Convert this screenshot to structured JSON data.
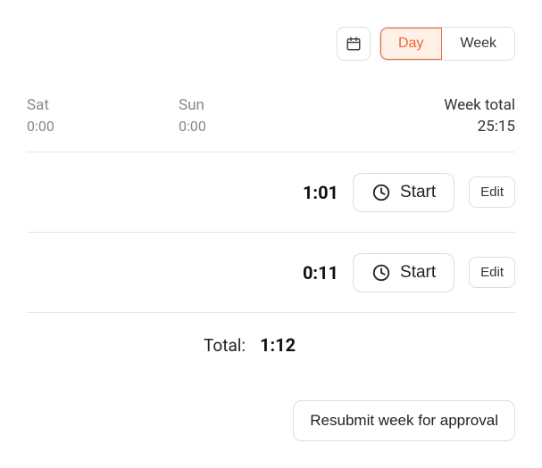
{
  "toolbar": {
    "tabs": {
      "day": "Day",
      "week": "Week"
    },
    "active_tab": "day"
  },
  "days": {
    "sat": {
      "label": "Sat",
      "value": "0:00"
    },
    "sun": {
      "label": "Sun",
      "value": "0:00"
    }
  },
  "week_total": {
    "label": "Week total",
    "value": "25:15"
  },
  "entries": [
    {
      "duration": "1:01",
      "start_label": "Start",
      "edit_label": "Edit"
    },
    {
      "duration": "0:11",
      "start_label": "Start",
      "edit_label": "Edit"
    }
  ],
  "total": {
    "label": "Total:",
    "value": "1:12"
  },
  "footer": {
    "resubmit_label": "Resubmit week for approval"
  }
}
